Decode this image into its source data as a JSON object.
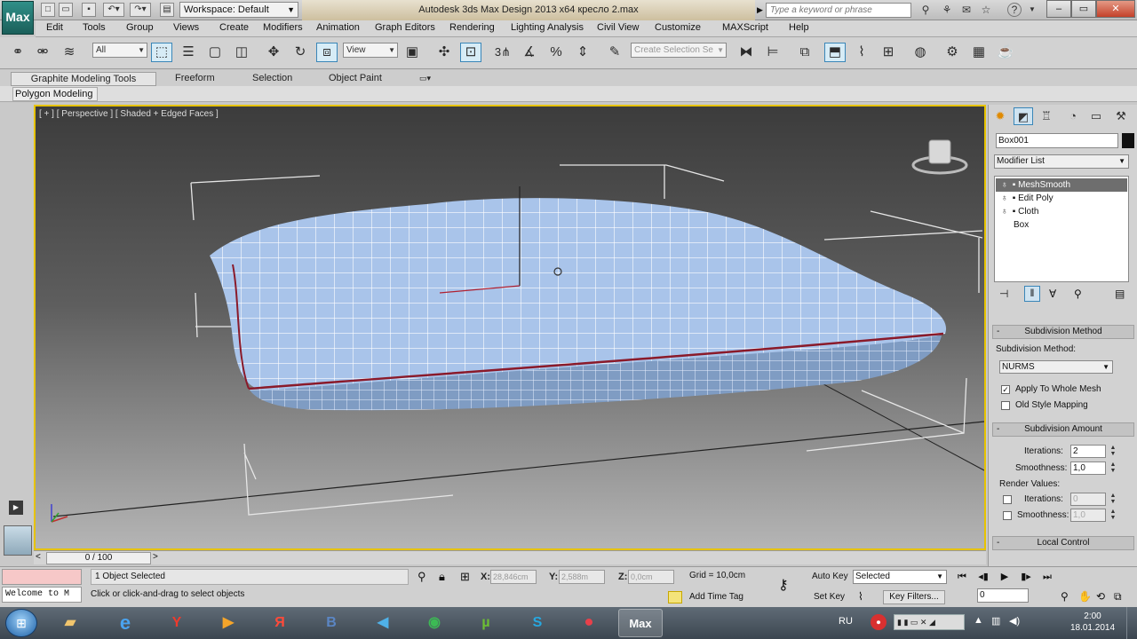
{
  "titlebar": {
    "app_logo": "Max",
    "workspace": "Workspace: Default",
    "title": "Autodesk 3ds Max Design 2013 x64        кресло 2.max",
    "search_placeholder": "Type a keyword or phrase",
    "help": "?"
  },
  "menu": [
    "Edit",
    "Tools",
    "Group",
    "Views",
    "Create",
    "Modifiers",
    "Animation",
    "Graph Editors",
    "Rendering",
    "Lighting Analysis",
    "Civil View",
    "Customize",
    "MAXScript",
    "Help"
  ],
  "toolbar": {
    "selection_filter": "All",
    "ref_coord": "View",
    "snap_number": "3",
    "named_selection_placeholder": "Create Selection Se"
  },
  "ribbon": {
    "tabs": [
      "Graphite Modeling Tools",
      "Freeform",
      "Selection",
      "Object Paint"
    ],
    "panel_label": "Polygon Modeling"
  },
  "viewport": {
    "label": "[ + ] [ Perspective ] [ Shaded + Edged Faces ]",
    "colors": {
      "border": "#e7c300",
      "mesh": "#a9c4ea",
      "wire": "#ffffff",
      "edge": "#8a1a2a"
    }
  },
  "timeline": {
    "frame": "0 / 100",
    "left_arrow": "<",
    "right_arrow": ">"
  },
  "command_panel": {
    "object_name": "Box001",
    "modifier_list": "Modifier List",
    "stack": [
      {
        "label": "MeshSmooth",
        "selected": true
      },
      {
        "label": "Edit Poly",
        "selected": false
      },
      {
        "label": "Cloth",
        "selected": false
      },
      {
        "label": "Box",
        "selected": false
      }
    ],
    "subdivision_method": {
      "header": "Subdivision Method",
      "label": "Subdivision Method:",
      "value": "NURMS",
      "apply_whole_mesh": "Apply To Whole Mesh",
      "apply_whole_mesh_checked": true,
      "old_style_mapping": "Old Style Mapping",
      "old_style_mapping_checked": false
    },
    "subdivision_amount": {
      "header": "Subdivision Amount",
      "iterations_label": "Iterations:",
      "iterations": "2",
      "smoothness_label": "Smoothness:",
      "smoothness": "1,0",
      "render_values_label": "Render Values:",
      "render_iterations_label": "Iterations:",
      "render_iterations": "0",
      "render_smoothness_label": "Smoothness:",
      "render_smoothness": "1,0"
    },
    "local_control": {
      "header": "Local Control"
    }
  },
  "statusbar": {
    "welcome": "Welcome to M",
    "selection": "1 Object Selected",
    "prompt": "Click or click-and-drag to select objects",
    "x_label": "X:",
    "x_value": "28,846cm",
    "y_label": "Y:",
    "y_value": "2,588m",
    "z_label": "Z:",
    "z_value": "0,0cm",
    "grid": "Grid = 10,0cm",
    "add_time_tag": "Add Time Tag",
    "auto_key": "Auto Key",
    "set_key": "Set Key",
    "selected_dropdown": "Selected",
    "key_filters": "Key Filters...",
    "frame": "0"
  },
  "taskbar": {
    "lang": "RU",
    "time": "2:00",
    "date": "18.01.2014",
    "apps": [
      "Explorer",
      "Internet Explorer",
      "Yandex",
      "Media Player",
      "Yandex Browser",
      "VK",
      "Sound",
      "Chrome",
      "uTorrent",
      "Skype",
      "Recorder",
      "3ds Max"
    ]
  }
}
